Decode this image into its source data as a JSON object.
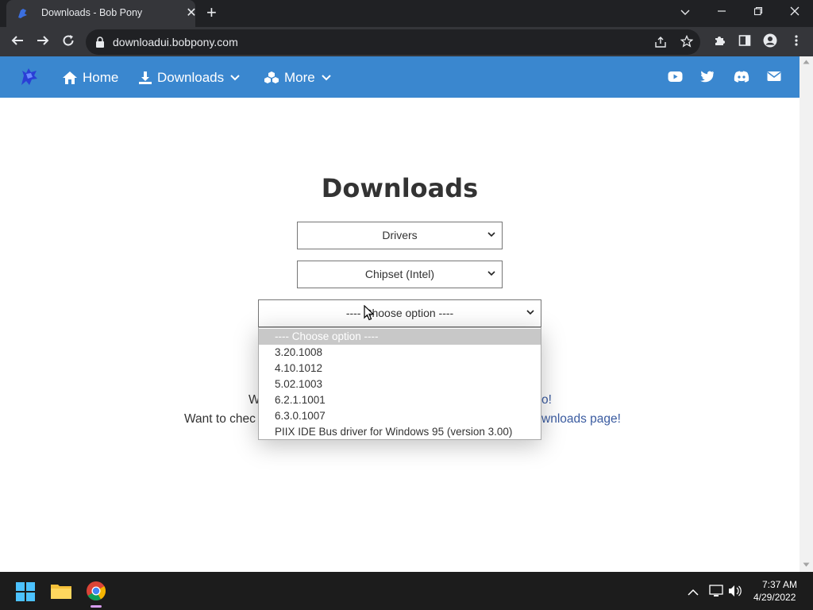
{
  "browser": {
    "tab_title": "Downloads - Bob Pony",
    "tab_close_glyph": "✕",
    "new_tab_glyph": "+",
    "url": "downloadui.bobpony.com"
  },
  "navbar": {
    "home_label": "Home",
    "downloads_label": "Downloads",
    "more_label": "More",
    "brand_color": "#3a87cf"
  },
  "main": {
    "title": "Downloads",
    "select1_value": "Drivers",
    "select2_value": "Chipset (Intel)",
    "select3_value": "---- Choose option ----",
    "partial_line1_left": "W",
    "partial_line1_right": "o!",
    "partial_line2_left": "Want to chec",
    "partial_line2_link": "wnloads page!"
  },
  "dropdown": {
    "options": [
      "---- Choose option ----",
      "3.20.1008",
      "4.10.1012",
      "5.02.1003",
      "6.2.1.1001",
      "6.3.0.1007",
      "PIIX IDE Bus driver for Windows 95 (version 3.00)"
    ],
    "selected_index": 0
  },
  "taskbar": {
    "time": "7:37 AM",
    "date": "4/29/2022"
  }
}
